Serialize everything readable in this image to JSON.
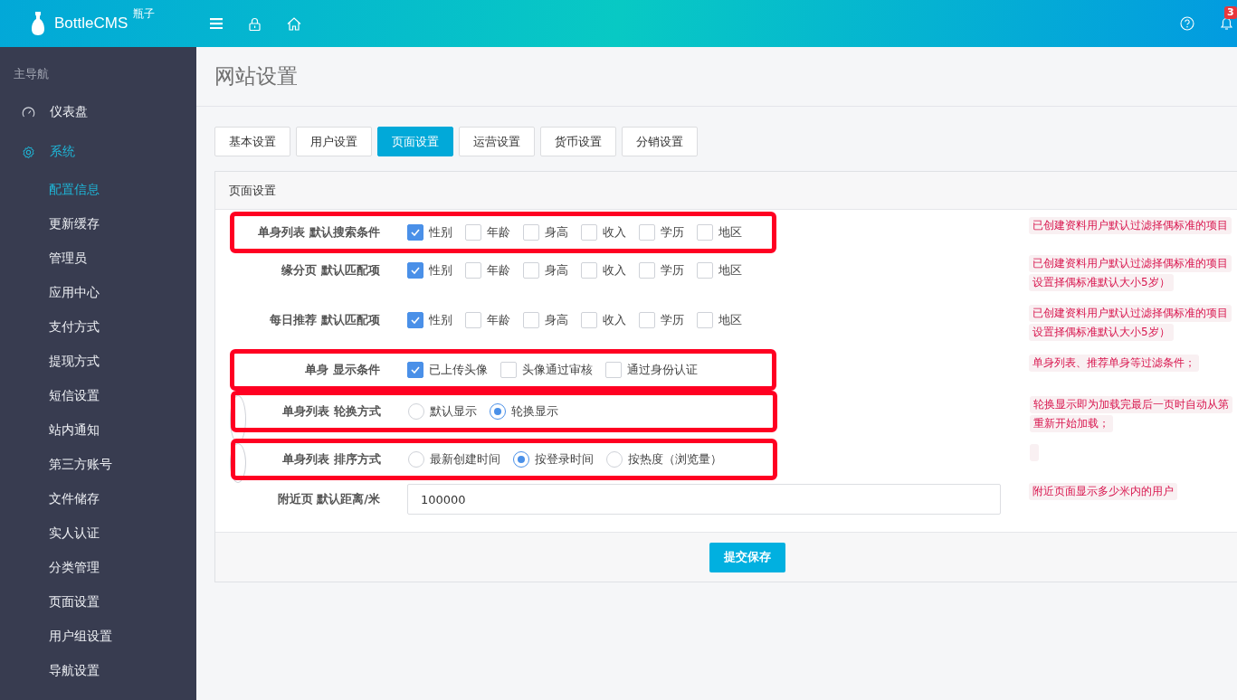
{
  "header": {
    "logo_text": "BottleCMS",
    "logo_sup": "瓶子",
    "badge": "3"
  },
  "sidebar": {
    "heading": "主导航",
    "items": [
      {
        "label": "仪表盘",
        "selected": false
      },
      {
        "label": "系统",
        "selected": true,
        "children": [
          {
            "label": "配置信息",
            "selected": true
          },
          {
            "label": "更新缓存",
            "selected": false
          },
          {
            "label": "管理员",
            "selected": false
          },
          {
            "label": "应用中心",
            "selected": false
          },
          {
            "label": "支付方式",
            "selected": false
          },
          {
            "label": "提现方式",
            "selected": false
          },
          {
            "label": "短信设置",
            "selected": false
          },
          {
            "label": "站内通知",
            "selected": false
          },
          {
            "label": "第三方账号",
            "selected": false
          },
          {
            "label": "文件储存",
            "selected": false
          },
          {
            "label": "实人认证",
            "selected": false
          },
          {
            "label": "分类管理",
            "selected": false
          },
          {
            "label": "页面设置",
            "selected": false
          },
          {
            "label": "用户组设置",
            "selected": false
          },
          {
            "label": "导航设置",
            "selected": false
          }
        ]
      }
    ]
  },
  "page_title": "网站设置",
  "tabs": [
    {
      "label": "基本设置",
      "selected": false
    },
    {
      "label": "用户设置",
      "selected": false
    },
    {
      "label": "页面设置",
      "selected": true
    },
    {
      "label": "运营设置",
      "selected": false
    },
    {
      "label": "货币设置",
      "selected": false
    },
    {
      "label": "分销设置",
      "selected": false
    }
  ],
  "panel": {
    "title": "页面设置",
    "rows": [
      {
        "kind": "checkbox",
        "label": "单身列表 默认搜索条件",
        "highlighted": true,
        "options": [
          {
            "label": "性别",
            "checked": true
          },
          {
            "label": "年龄",
            "checked": false
          },
          {
            "label": "身高",
            "checked": false
          },
          {
            "label": "收入",
            "checked": false
          },
          {
            "label": "学历",
            "checked": false
          },
          {
            "label": "地区",
            "checked": false
          }
        ],
        "hint": [
          "已创建资料用户默认过滤择偶标准的项目"
        ]
      },
      {
        "kind": "checkbox",
        "label": "缘分页 默认匹配项",
        "highlighted": false,
        "options": [
          {
            "label": "性别",
            "checked": true
          },
          {
            "label": "年龄",
            "checked": false
          },
          {
            "label": "身高",
            "checked": false
          },
          {
            "label": "收入",
            "checked": false
          },
          {
            "label": "学历",
            "checked": false
          },
          {
            "label": "地区",
            "checked": false
          }
        ],
        "hint": [
          "已创建资料用户默认过滤择偶标准的项目",
          "设置择偶标准默认大小5岁）"
        ]
      },
      {
        "kind": "checkbox",
        "label": "每日推荐 默认匹配项",
        "highlighted": false,
        "options": [
          {
            "label": "性别",
            "checked": true
          },
          {
            "label": "年龄",
            "checked": false
          },
          {
            "label": "身高",
            "checked": false
          },
          {
            "label": "收入",
            "checked": false
          },
          {
            "label": "学历",
            "checked": false
          },
          {
            "label": "地区",
            "checked": false
          }
        ],
        "hint": [
          "已创建资料用户默认过滤择偶标准的项目",
          "设置择偶标准默认大小5岁）"
        ]
      },
      {
        "kind": "checkbox",
        "label": "单身 显示条件",
        "highlighted": true,
        "options": [
          {
            "label": "已上传头像",
            "checked": true
          },
          {
            "label": "头像通过审核",
            "checked": false
          },
          {
            "label": "通过身份认证",
            "checked": false
          }
        ],
        "hint": [
          "单身列表、推荐单身等过滤条件；"
        ]
      },
      {
        "kind": "radio",
        "label": "单身列表 轮换方式",
        "highlighted": true,
        "options": [
          {
            "label": "默认显示",
            "selected": false
          },
          {
            "label": "轮换显示",
            "selected": true
          }
        ],
        "hint": [
          "轮换显示即为加载完最后一页时自动从第",
          "重新开始加载；"
        ]
      },
      {
        "kind": "radio",
        "label": "单身列表 排序方式",
        "highlighted": true,
        "options": [
          {
            "label": "最新创建时间",
            "selected": false
          },
          {
            "label": "按登录时间",
            "selected": true
          },
          {
            "label": "按热度（浏览量）",
            "selected": false
          }
        ],
        "empty_hint": true
      },
      {
        "kind": "text",
        "label": "附近页 默认距离/米",
        "highlighted": false,
        "value": "100000",
        "hint": [
          "附近页面显示多少米内的用户"
        ]
      }
    ]
  },
  "submit": "提交保存"
}
